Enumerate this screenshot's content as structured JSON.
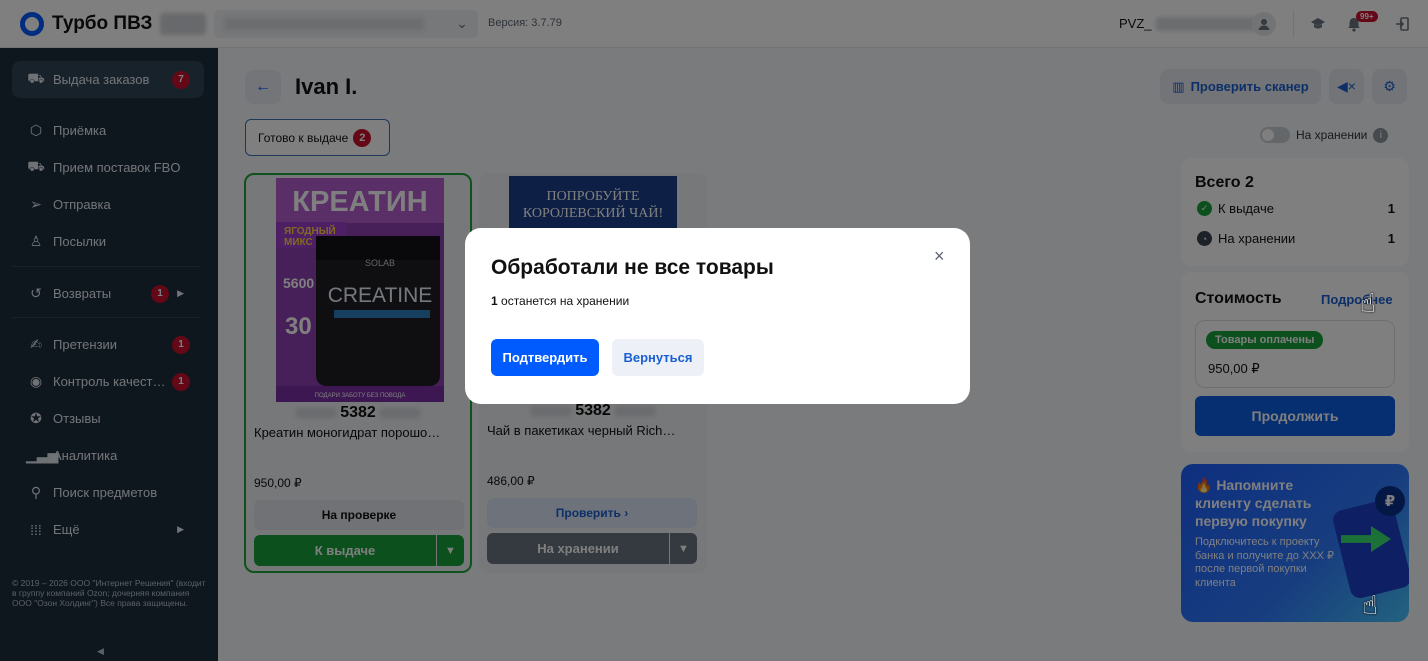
{
  "app": {
    "name": "Турбо ПВЗ",
    "version": "Версия: 3.7.79",
    "pvz_label": "PVZ_",
    "notif_badge": "99+"
  },
  "sidebar": {
    "items": [
      {
        "label": "Выдача заказов",
        "icon": "truck-icon",
        "badge": "7"
      },
      {
        "label": "Приёмка",
        "icon": "box-icon"
      },
      {
        "label": "Прием поставок FBO",
        "icon": "delivery-icon"
      },
      {
        "label": "Отправка",
        "icon": "send-icon"
      },
      {
        "label": "Посылки",
        "icon": "user-icon"
      },
      {
        "label": "Возвраты",
        "icon": "return-icon",
        "badge": "1"
      },
      {
        "label": "Претензии",
        "icon": "claim-icon",
        "badge": "1"
      },
      {
        "label": "Контроль качест…",
        "icon": "eye-icon",
        "badge": "1"
      },
      {
        "label": "Отзывы",
        "icon": "review-icon"
      },
      {
        "label": "Аналитика",
        "icon": "chart-icon"
      },
      {
        "label": "Поиск предметов",
        "icon": "search-icon"
      },
      {
        "label": "Ещё",
        "icon": "grid-icon"
      }
    ],
    "copyright": "© 2019 – 2026 ООО \"Интернет Решения\" (входит в группу компаний Ozon; дочерняя компания ООО \"Озон Холдинг\") Все права защищены."
  },
  "main": {
    "title": "Ivan I.",
    "tab_label": "Готово к выдаче",
    "tab_count": "2",
    "cards": [
      {
        "code": "5382",
        "name": "Креатин моногидрат порошо…",
        "price": "950,00 ₽",
        "status": "На проверке",
        "action": "К выдаче",
        "img": {
          "l1": "КРЕАТИН",
          "l2": "ЯГОДНЫЙ",
          "l3": "МИКС",
          "l4": "5600",
          "l5": "30",
          "l6": "SOLAB",
          "l7": "CREATINE",
          "l8": "ПОДАРИ ЗАБОТУ БЕЗ ПОВОДА"
        }
      },
      {
        "code": "5382",
        "name": "Чай в пакетиках черный Rich…",
        "price": "486,00 ₽",
        "status": "Проверить",
        "action": "На хранении",
        "img": {
          "l1": "ПОПРОБУЙТЕ",
          "l2": "КОРОЛЕВСКИЙ ЧАЙ!"
        }
      }
    ]
  },
  "right": {
    "scanner_label": "Проверить сканер",
    "storage_toggle": "На хранении",
    "summary": {
      "title": "Всего 2",
      "to_issue_label": "К выдаче",
      "to_issue": "1",
      "storage_label": "На хранении",
      "storage": "1"
    },
    "cost": {
      "title": "Стоимость",
      "link": "Подробнее",
      "paid_tag": "Товары оплачены",
      "amount": "950,00 ₽",
      "continue": "Продолжить"
    },
    "promo": {
      "title": "🔥 Напомните клиенту сделать первую покупку",
      "text": "Подключитесь к проекту банка и получите до XXX ₽ после первой покупки клиента",
      "coin": "₽"
    }
  },
  "modal": {
    "title": "Обработали не все товары",
    "count": "1",
    "text": " останется на хранении",
    "confirm": "Подтвердить",
    "back": "Вернуться",
    "close": "×"
  }
}
